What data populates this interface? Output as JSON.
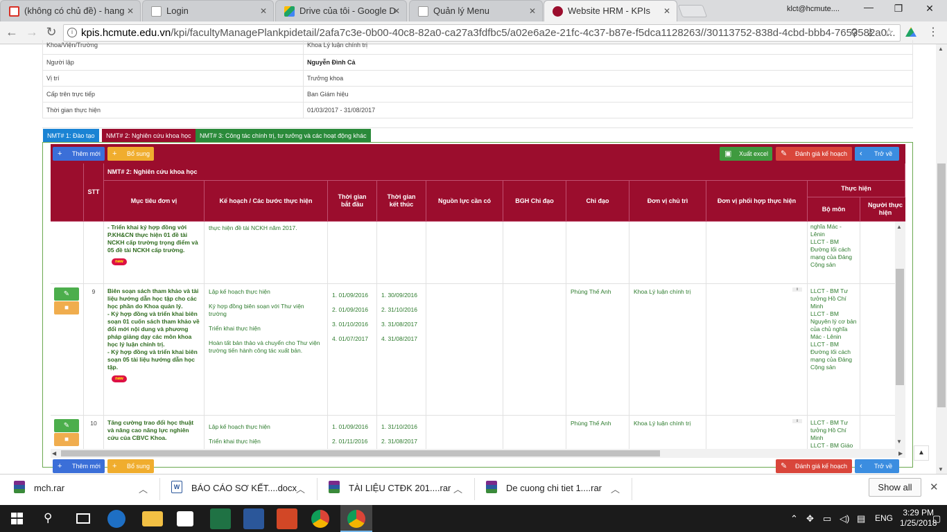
{
  "browser": {
    "tabs": [
      {
        "label": "(không có chủ đề) - hang",
        "icon": "gmail-icon",
        "color": "#d93025"
      },
      {
        "label": "Login",
        "icon": "page-icon",
        "color": "#888888"
      },
      {
        "label": "Drive của tôi - Google D",
        "icon": "drive-icon",
        "color": "#1fa463"
      },
      {
        "label": "Quản lý Menu",
        "icon": "page-icon",
        "color": "#888888"
      },
      {
        "label": "Website HRM - KPIs",
        "icon": "hcmute-icon",
        "color": "#9b0d2d"
      }
    ],
    "user": "klct@hcmute....",
    "url_host": "kpis.hcmute.edu.vn",
    "url_path": "/kpi/facultyManagePlankpidetail/2afa7c3e-0b00-40c8-82a0-ca27a3fdfbc5/a02e6a2e-21fc-4c37-b87e-f5dca1128263//30113752-838d-4cbd-bbb4-7653582a0..."
  },
  "info": [
    {
      "key": "Khoa/Viện/Trường",
      "value": "Khoa Lý luận chính trị"
    },
    {
      "key": "Người lập",
      "value": "Nguyễn Đình Cả"
    },
    {
      "key": "Vị trí",
      "value": "Trưởng khoa"
    },
    {
      "key": "Cấp trên trực tiếp",
      "value": "Ban Giám hiệu"
    },
    {
      "key": "Thời gian thực hiện",
      "value": "01/03/2017 - 31/08/2017"
    }
  ],
  "nmt_tabs": [
    {
      "label": "NMT# 1: Đào tạo",
      "color": "#1a83d4"
    },
    {
      "label": "NMT# 2: Nghiên cứu khoa học",
      "color": "#9b0d2d"
    },
    {
      "label": "NMT# 3: Công tác chính trị, tư tưởng và các hoạt động khác",
      "color": "#2a8a3a"
    }
  ],
  "actions": {
    "add": "Thêm mới",
    "supplement": "Bổ sung",
    "export": "Xuất excel",
    "evaluate": "Đánh giá kế hoạch",
    "back": "Trở về"
  },
  "table": {
    "section_title": "NMT# 2: Nghiên cứu khoa học",
    "headers": {
      "stt": "STT",
      "goal": "Mục tiêu đơn vị",
      "plan": "Kế hoạch / Các bước thực hiện",
      "start": "Thời gian bắt đầu",
      "end": "Thời gian kết thúc",
      "resources": "Nguồn lực cần có",
      "bgh": "BGH Chỉ đạo",
      "director": "Chỉ đạo",
      "owner": "Đơn vị chủ trì",
      "partner": "Đơn vị phối hợp thực hiện",
      "execution": "Thực hiện",
      "dept": "Bộ môn",
      "person": "Người thực hiện"
    },
    "partial_row": {
      "goal": "- Triển khai ký hợp đồng với P.KH&CN thực hiện 01 đề tài NCKH cấp trường trọng điểm và 05 đề tài NCKH cấp trường.",
      "plan": "thực hiện đề tài NCKH năm 2017.",
      "dept": "nghĩa Mác - Lênin\nLLCT - BM Đường lối cách mạng của Đảng Cộng sản"
    },
    "rows": [
      {
        "stt": "9",
        "goal": "Biên soạn sách tham khảo và tài liệu hướng dẫn học tập cho các học phần do Khoa quản lý.\n- Ký hợp đồng và triển khai biên soạn 01 cuốn sách tham khảo về đổi mới nội dung và phương pháp giảng dạy các môn khoa học lý luận chính trị.\n- Ký hợp đồng và triển khai biên soạn 05 tài liệu hướng dẫn học tập.",
        "plans": [
          "Lập kế hoạch thực hiện",
          "Ký hợp đồng biên soạn với Thư viện trường",
          "Triển khai thực hiện",
          "Hoàn tất bản thảo và chuyển cho Thư viện trường tiến hành công tác xuất bản."
        ],
        "starts": [
          "1. 01/09/2016",
          "2. 01/09/2016",
          "3. 01/10/2016",
          "4. 01/07/2017"
        ],
        "ends": [
          "1. 30/09/2016",
          "2. 31/10/2016",
          "3. 31/08/2017",
          "4. 31/08/2017"
        ],
        "director": "Phùng Thế Anh",
        "owner": "Khoa Lý luận chính trị",
        "dept": "LLCT - BM Tư tưởng Hồ Chí Minh\nLLCT - BM Nguyên lý cơ bản của chủ nghĩa Mác - Lênin\nLLCT - BM Đường lối cách mạng của Đảng Cộng sản"
      },
      {
        "stt": "10",
        "goal": "Tăng cường trao đổi học thuật và nâng cao năng lực nghiên cứu của CBVC Khoa.",
        "plans": [
          "Lập kế hoạch thực hiện",
          "Triển khai thực hiện"
        ],
        "starts": [
          "1. 01/09/2016",
          "2. 01/11/2016"
        ],
        "ends": [
          "1. 31/10/2016",
          "2. 31/08/2017"
        ],
        "director": "Phùng Thế Anh",
        "owner": "Khoa Lý luận chính trị",
        "dept": "LLCT - BM Tư tưởng Hồ Chí Minh\nLLCT - BM Giáo"
      }
    ],
    "badge": "new"
  },
  "downloads": [
    {
      "name": "mch.rar",
      "icon": "winrar-icon"
    },
    {
      "name": "BÁO CÁO SƠ KẾT....docx",
      "icon": "word-icon"
    },
    {
      "name": "TÀI LIỆU CTĐK 201....rar",
      "icon": "winrar-icon"
    },
    {
      "name": "De cuong chi tiet 1....rar",
      "icon": "winrar-icon"
    }
  ],
  "show_all": "Show all",
  "taskbar": {
    "lang": "ENG",
    "time": "3:29 PM",
    "date": "1/25/2018"
  }
}
